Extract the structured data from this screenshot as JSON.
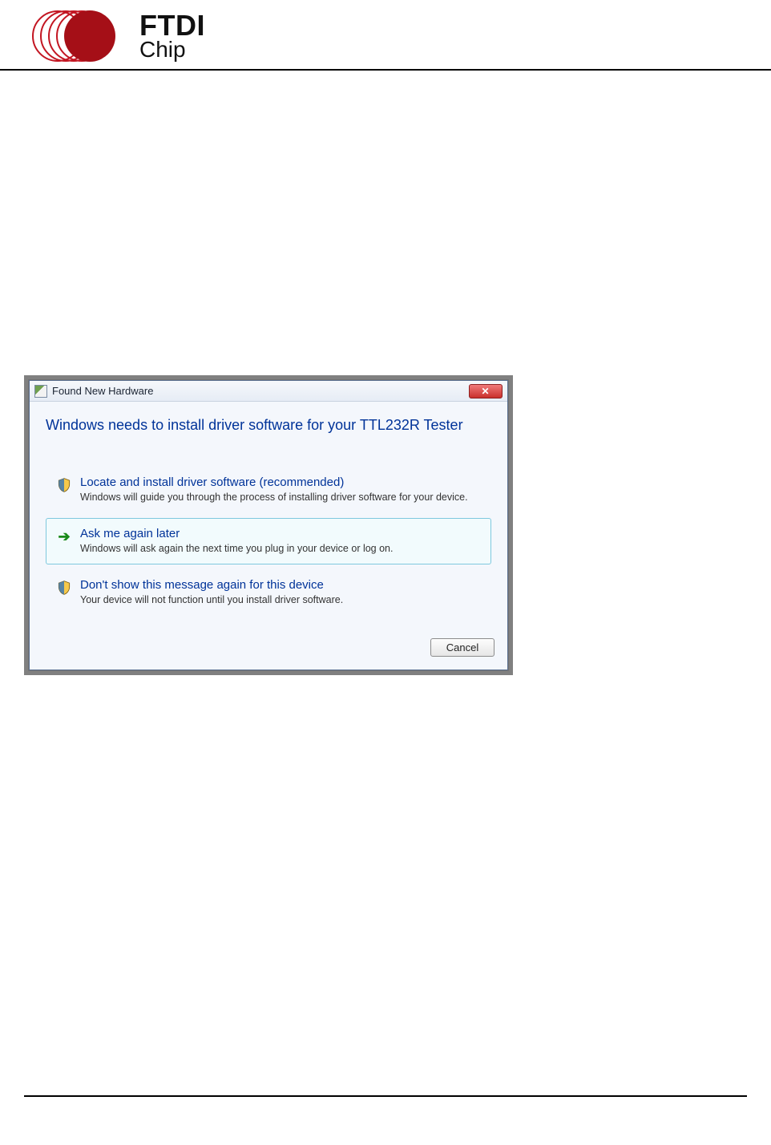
{
  "logo": {
    "line1": "FTDI",
    "line2": "Chip"
  },
  "dialog": {
    "title": "Found New Hardware",
    "close_label": "✕",
    "main_instruction": "Windows needs to install driver software for your TTL232R Tester",
    "options": [
      {
        "title": "Locate and install driver software (recommended)",
        "desc": "Windows will guide you through the process of installing driver software for your device."
      },
      {
        "title": "Ask me again later",
        "desc": "Windows will ask again the next time you plug in your device or log on."
      },
      {
        "title": "Don't show this message again for this device",
        "desc": "Your device will not function until you install driver software."
      }
    ],
    "cancel_label": "Cancel"
  }
}
